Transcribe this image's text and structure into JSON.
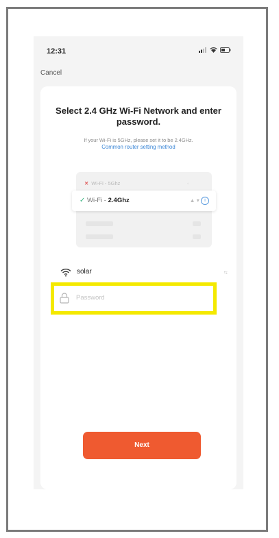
{
  "status_bar": {
    "time": "12:31"
  },
  "header": {
    "cancel_label": "Cancel"
  },
  "content": {
    "title": "Select 2.4 GHz Wi-Fi Network and enter password.",
    "subtitle": "If your Wi-Fi is 5GHz, please set it to be 2.4GHz.",
    "link": "Common router setting method"
  },
  "illustration": {
    "bad_network": {
      "prefix": "Wi-Fi - ",
      "band": "5Ghz"
    },
    "good_network": {
      "prefix": "Wi-Fi - ",
      "band": "2.4Ghz"
    }
  },
  "wifi": {
    "ssid": "solar",
    "switch_label": "⇆"
  },
  "password": {
    "placeholder": "Password"
  },
  "actions": {
    "next_label": "Next"
  },
  "colors": {
    "accent": "#ef5a30",
    "link": "#3a86d6",
    "highlight": "#f4e900",
    "check": "#36b37e",
    "error": "#e05a5a"
  }
}
